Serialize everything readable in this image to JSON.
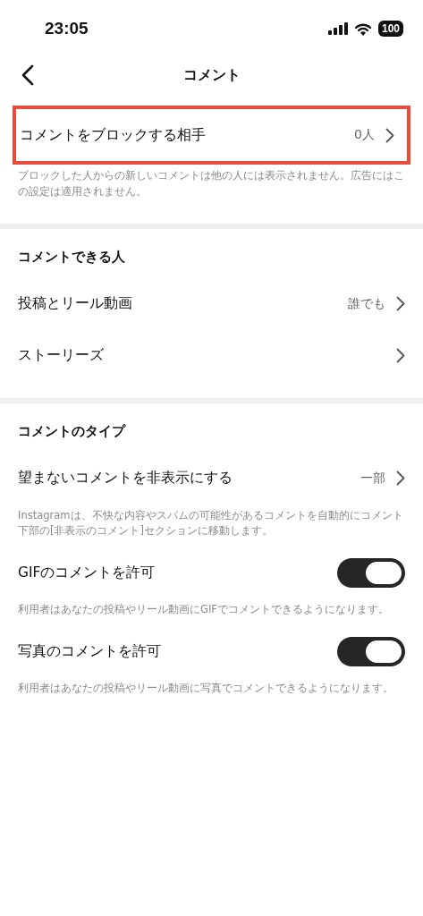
{
  "status_bar": {
    "time": "23:05",
    "battery": "100"
  },
  "header": {
    "title": "コメント"
  },
  "sections": [
    {
      "items": [
        {
          "kind": "link",
          "label": "コメントをブロックする相手",
          "value": "0人",
          "highlighted": true,
          "description": "ブロックした人からの新しいコメントは他の人には表示されません。広告にはこの設定は適用されません。"
        }
      ]
    },
    {
      "heading": "コメントできる人",
      "items": [
        {
          "kind": "link",
          "label": "投稿とリール動画",
          "value": "誰でも",
          "highlighted": false
        },
        {
          "kind": "link",
          "label": "ストーリーズ",
          "highlighted": false
        }
      ]
    },
    {
      "heading": "コメントのタイプ",
      "items": [
        {
          "kind": "link",
          "label": "望まないコメントを非表示にする",
          "value": "一部",
          "highlighted": false,
          "description": "Instagramは、不快な内容やスパムの可能性があるコメントを自動的にコメント下部の[非表示のコメント]セクションに移動します。"
        },
        {
          "kind": "toggle",
          "label": "GIFのコメントを許可",
          "on": true,
          "highlighted": false,
          "description": "利用者はあなたの投稿やリール動画にGIFでコメントできるようになります。"
        },
        {
          "kind": "toggle",
          "label": "写真のコメントを許可",
          "on": true,
          "highlighted": false,
          "description": "利用者はあなたの投稿やリール動画に写真でコメントできるようになります。"
        }
      ]
    }
  ]
}
